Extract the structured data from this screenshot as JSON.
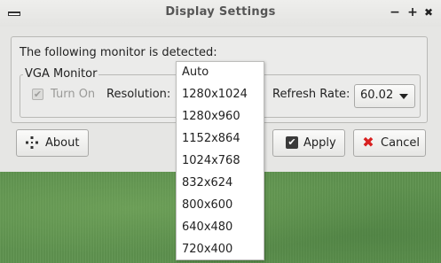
{
  "window": {
    "title": "Display Settings",
    "controls": {
      "minimize": "−",
      "maximize": "+",
      "close": "✖"
    }
  },
  "main": {
    "detected_text": "The following monitor is detected:",
    "monitor_group_label": "VGA Monitor",
    "turn_on_label": "Turn On",
    "resolution_label": "Resolution:",
    "refresh_rate_label": "Refresh Rate:",
    "refresh_rate_value": "60.02"
  },
  "buttons": {
    "about": "About",
    "apply": "Apply",
    "cancel": "Cancel"
  },
  "resolution_options": [
    "Auto",
    "1280x1024",
    "1280x960",
    "1152x864",
    "1024x768",
    "832x624",
    "800x600",
    "640x480",
    "720x400"
  ]
}
